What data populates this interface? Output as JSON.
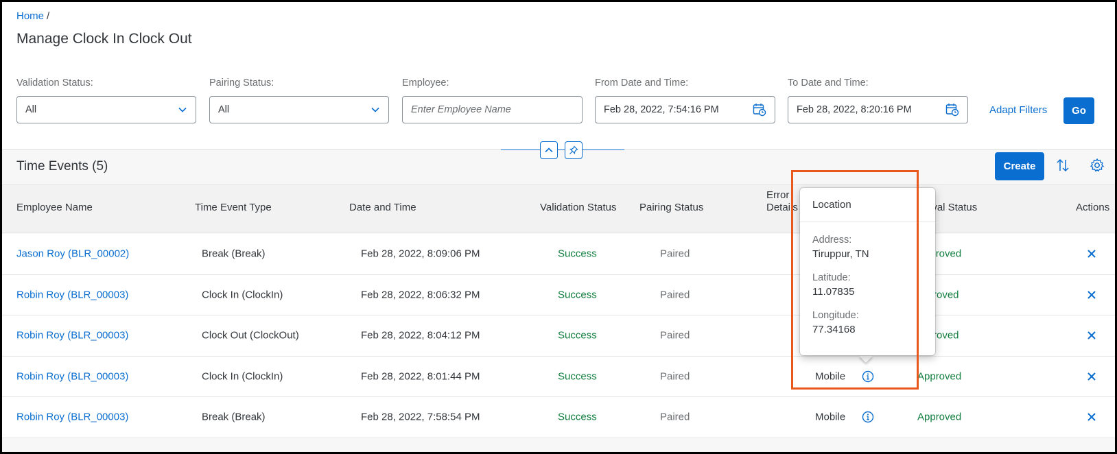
{
  "breadcrumb": {
    "home": "Home",
    "separator": "/"
  },
  "page": {
    "title": "Manage Clock In Clock Out"
  },
  "filters": {
    "validation_status": {
      "label": "Validation Status:",
      "value": "All"
    },
    "pairing_status": {
      "label": "Pairing Status:",
      "value": "All"
    },
    "employee": {
      "label": "Employee:",
      "placeholder": "Enter Employee Name"
    },
    "from_date": {
      "label": "From Date and Time:",
      "value": "Feb 28, 2022, 7:54:16 PM"
    },
    "to_date": {
      "label": "To Date and Time:",
      "value": "Feb 28, 2022, 8:20:16 PM"
    },
    "adapt_label": "Adapt Filters",
    "go_label": "Go"
  },
  "table": {
    "title": "Time Events (5)",
    "create_label": "Create",
    "columns": {
      "employee": "Employee Name",
      "type": "Time Event Type",
      "datetime": "Date and Time",
      "validation": "Validation Status",
      "pairing": "Pairing Status",
      "error1": "Error",
      "error2": "Details",
      "approval": "roval Status",
      "actions": "Actions"
    },
    "rows": [
      {
        "employee": "Jason Roy (BLR_00002)",
        "type": "Break (Break)",
        "datetime": "Feb 28, 2022, 8:09:06 PM",
        "validation": "Success",
        "pairing": "Paired",
        "source": "",
        "approval": "Approved"
      },
      {
        "employee": "Robin Roy (BLR_00003)",
        "type": "Clock In (ClockIn)",
        "datetime": "Feb 28, 2022, 8:06:32 PM",
        "validation": "Success",
        "pairing": "Paired",
        "source": "",
        "approval": "roved"
      },
      {
        "employee": "Robin Roy (BLR_00003)",
        "type": "Clock Out (ClockOut)",
        "datetime": "Feb 28, 2022, 8:04:12 PM",
        "validation": "Success",
        "pairing": "Paired",
        "source": "",
        "approval": "roved"
      },
      {
        "employee": "Robin Roy (BLR_00003)",
        "type": "Clock In (ClockIn)",
        "datetime": "Feb 28, 2022, 8:01:44 PM",
        "validation": "Success",
        "pairing": "Paired",
        "source": "Mobile",
        "approval": "Approved"
      },
      {
        "employee": "Robin Roy (BLR_00003)",
        "type": "Break (Break)",
        "datetime": "Feb 28, 2022, 7:58:54 PM",
        "validation": "Success",
        "pairing": "Paired",
        "source": "Mobile",
        "approval": "Approved"
      }
    ]
  },
  "popover": {
    "title": "Location",
    "address_label": "Address:",
    "address_value": "Tiruppur, TN",
    "latitude_label": "Latitude:",
    "latitude_value": "11.07835",
    "longitude_label": "Longitude:",
    "longitude_value": "77.34168"
  },
  "colors": {
    "accent": "#0a6ed1",
    "positive": "#107e3e",
    "highlight": "#e8581c"
  },
  "icons": [
    "chevron-down-icon",
    "calendar-icon",
    "collapse-icon",
    "pin-icon",
    "sort-icon",
    "gear-icon",
    "info-icon",
    "close-icon"
  ]
}
